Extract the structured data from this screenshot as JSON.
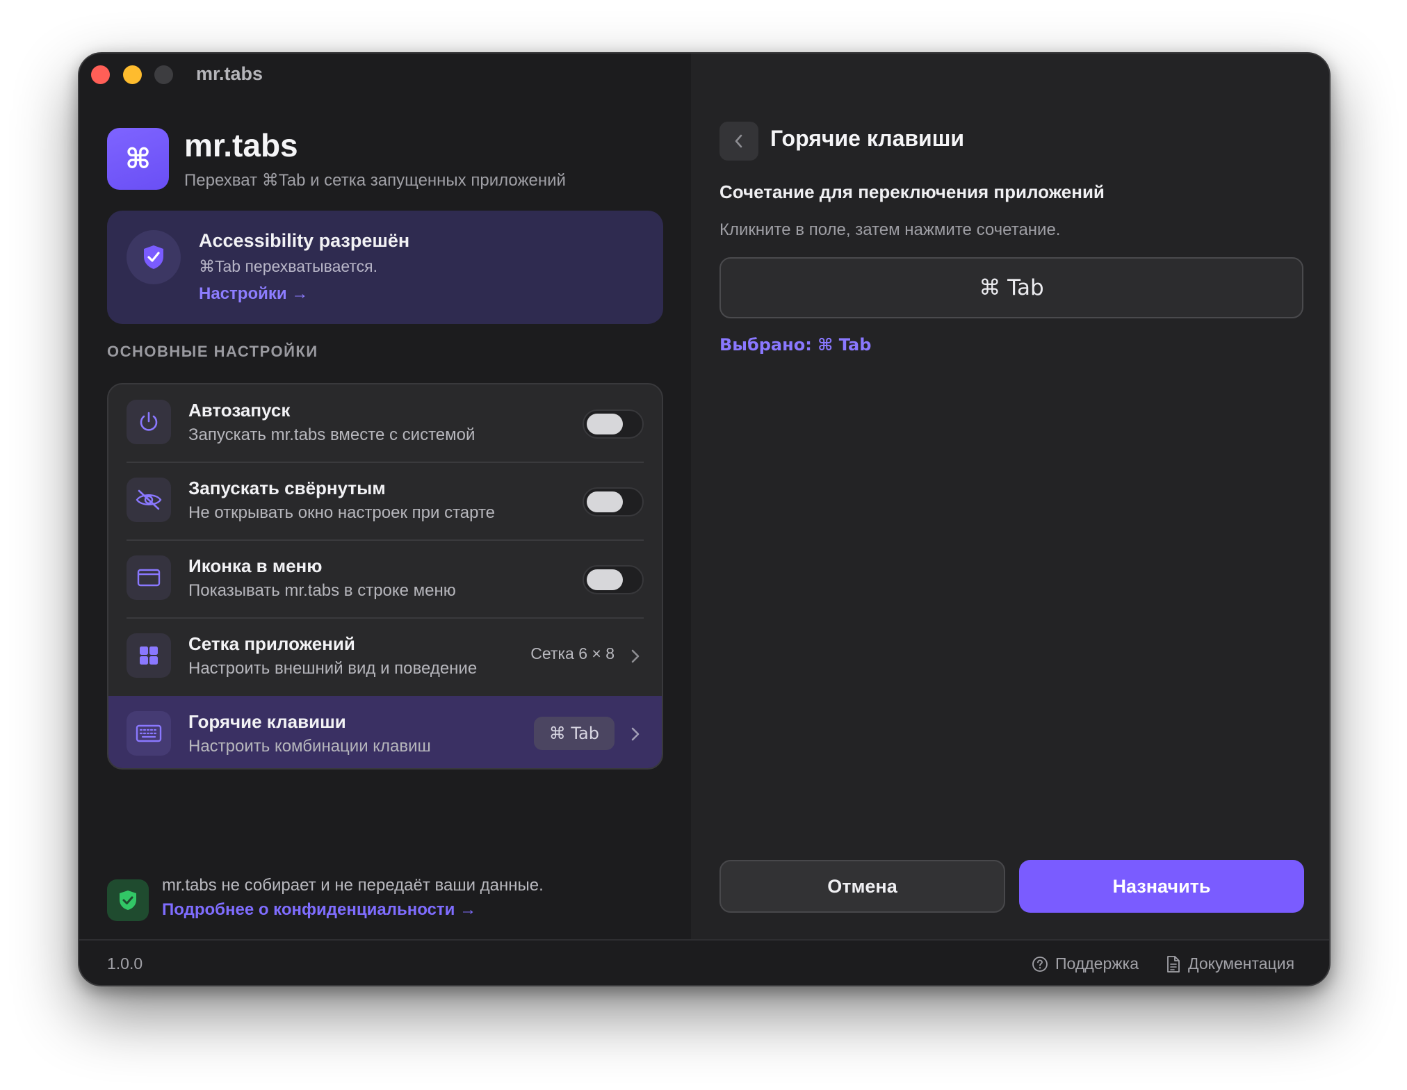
{
  "window": {
    "title": "mr.tabs"
  },
  "app": {
    "icon_glyph": "⌘",
    "name": "mr.tabs",
    "subtitle": "Перехват ⌘Tab и сетка запущенных приложений"
  },
  "accessibility": {
    "icon": "shield-check-icon",
    "title": "Accessibility разрешён",
    "subtitle": "⌘Tab перехватывается.",
    "link": "Настройки →"
  },
  "settings": {
    "heading": "ОСНОВНЫЕ НАСТРОЙКИ",
    "items": [
      {
        "icon": "power-icon",
        "title": "Автозапуск",
        "subtitle": "Запускать mr.tabs вместе с системой",
        "toggle_on": false
      },
      {
        "icon": "eye-off-icon",
        "title": "Запускать свёрнутым",
        "subtitle": "Не открывать окно настроек при старте",
        "toggle_on": false
      },
      {
        "icon": "menubar-icon",
        "title": "Иконка в меню",
        "subtitle": "Показывать mr.tabs в строке меню",
        "toggle_on": false
      },
      {
        "icon": "grid-icon",
        "title": "Сетка приложений",
        "subtitle": "Настроить внешний вид и поведение",
        "value": "Сетка 6 × 8"
      },
      {
        "icon": "keyboard-icon",
        "title": "Горячие клавиши",
        "subtitle": "Настроить комбинации клавиш",
        "value": "⌘ Tab",
        "selected": true
      }
    ]
  },
  "privacy": {
    "icon": "shield-check-icon",
    "text": "mr.tabs не собирает и не передаёт ваши данные.",
    "link": "Подробнее о конфиденциальности →"
  },
  "hotkeys_panel": {
    "back_icon": "chevron-left-icon",
    "title": "Горячие клавиши",
    "combo_heading": "Сочетание для переключения приложений",
    "hint": "Кликните в поле, затем нажмите сочетание.",
    "field_value": "⌘ Tab",
    "selected_label": "Выбрано: ⌘ Tab",
    "cancel_label": "Отмена",
    "assign_label": "Назначить"
  },
  "status_bar": {
    "version": "1.0.0",
    "support_label": "Поддержка",
    "docs_label": "Документация"
  },
  "colors": {
    "accent": "#7a5cff",
    "link": "#8d7dff",
    "access_card_bg": "#2f2b50",
    "privacy_green": "#32c766",
    "close": "#ff5f57",
    "minimize": "#febc2e"
  }
}
